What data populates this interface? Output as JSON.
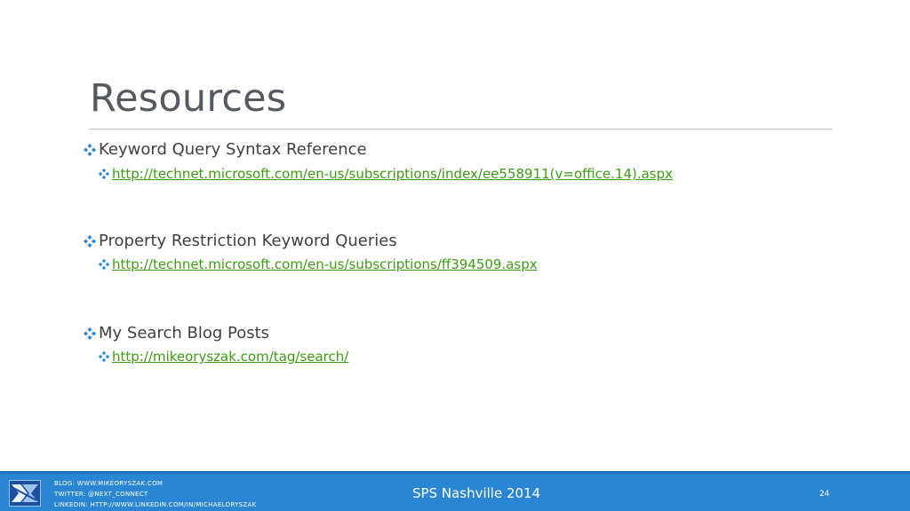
{
  "slide": {
    "title": "Resources",
    "sections": [
      {
        "heading": "Keyword Query Syntax Reference",
        "link": "http://technet.microsoft.com/en-us/subscriptions/index/ee558911(v=office.14).aspx"
      },
      {
        "heading": "Property Restriction Keyword Queries",
        "link": "http://technet.microsoft.com/en-us/subscriptions/ff394509.aspx"
      },
      {
        "heading": "My Search Blog Posts",
        "link": "http://mikeoryszak.com/tag/search/"
      }
    ]
  },
  "footer": {
    "blog": "BLOG:  WWW.MIKEORYSZAK.COM",
    "twitter": "TWITTER:  @NEXT_CONNECT",
    "linkedin": "LINKEDIN:  HTTP://WWW.LINKEDIN.COM/IN/MICHAELORYSZAK",
    "event": "SPS Nashville 2014",
    "page_number": "24"
  },
  "colors": {
    "title": "#555a60",
    "bullet": "#2a86d2",
    "link": "#3e9b14",
    "footer_bg": "#2a86d2"
  },
  "icons": {
    "bullet": "four-diamond-bullet-icon",
    "logo": "next-connect-logo"
  }
}
